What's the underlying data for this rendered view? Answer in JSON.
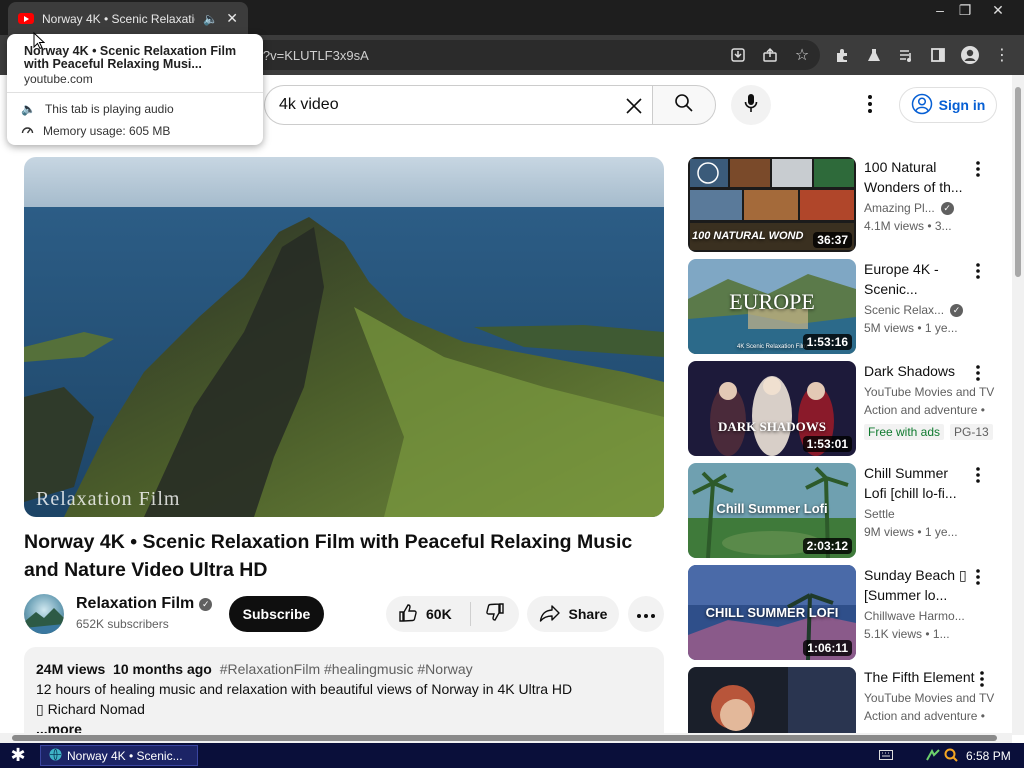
{
  "browser": {
    "tab_title": "Norway 4K • Scenic Relaxation",
    "url_fragment": "i?v=KLUTLF3x9sA",
    "hover_card": {
      "title": "Norway 4K • Scenic Relaxation Film with Peaceful Relaxing Musi...",
      "domain": "youtube.com",
      "audio_text": "This tab is playing audio",
      "memory_text": "Memory usage: 605 MB"
    }
  },
  "header": {
    "search_value": "4k video",
    "sign_in_label": "Sign in"
  },
  "video": {
    "watermark": "Relaxation Film",
    "title": "Norway 4K • Scenic Relaxation Film with Peaceful Relaxing Music and Nature Video Ultra HD",
    "channel": {
      "name": "Relaxation Film",
      "subscribers": "652K subscribers"
    },
    "subscribe_label": "Subscribe",
    "likes": "60K",
    "share_label": "Share",
    "description": {
      "views": "24M views",
      "age": "10 months ago",
      "tags": "#RelaxationFilm #healingmusic #Norway",
      "line1": "12 hours of healing music and relaxation with beautiful views of Norway in 4K Ultra HD",
      "line2": "▯ Richard Nomad",
      "more": "...more"
    }
  },
  "recommendations": [
    {
      "title": "100 Natural Wonders of th...",
      "channel": "Amazing Pl...",
      "verified": true,
      "stats": "4.1M views • 3...",
      "duration": "36:37",
      "thumb_text": "100 NATURAL WOND"
    },
    {
      "title": "Europe 4K - Scenic...",
      "channel": "Scenic Relax...",
      "verified": true,
      "stats": "5M views • 1 ye...",
      "duration": "1:53:16",
      "thumb_text": "EUROPE",
      "thumb_sub": "4K Scenic Relaxation Film"
    },
    {
      "title": "Dark Shadows",
      "channel": "YouTube Movies and TV",
      "stats": "Action and adventure •",
      "badge1": "Free with ads",
      "badge2": "PG-13",
      "duration": "1:53:01",
      "thumb_text": "DARK SHADOWS"
    },
    {
      "title": "Chill Summer Lofi [chill lo-fi...",
      "channel": "Settle",
      "stats": "9M views • 1 ye...",
      "duration": "2:03:12",
      "thumb_text": "Chill Summer Lofi"
    },
    {
      "title": "Sunday Beach ▯ [Summer lo...",
      "channel": "Chillwave Harmo...",
      "stats": "5.1K views • 1...",
      "duration": "1:06:11",
      "thumb_text": "CHILL SUMMER LOFI"
    },
    {
      "title": "The Fifth Element",
      "channel": "YouTube Movies and TV",
      "stats": "Action and adventure •"
    }
  ],
  "taskbar": {
    "task_label": "Norway 4K • Scenic...",
    "clock": "6:58 PM"
  },
  "colors": {
    "brand_red": "#ff0000",
    "link_blue": "#065fd4",
    "taskbar_bg": "#0a0f3a"
  }
}
